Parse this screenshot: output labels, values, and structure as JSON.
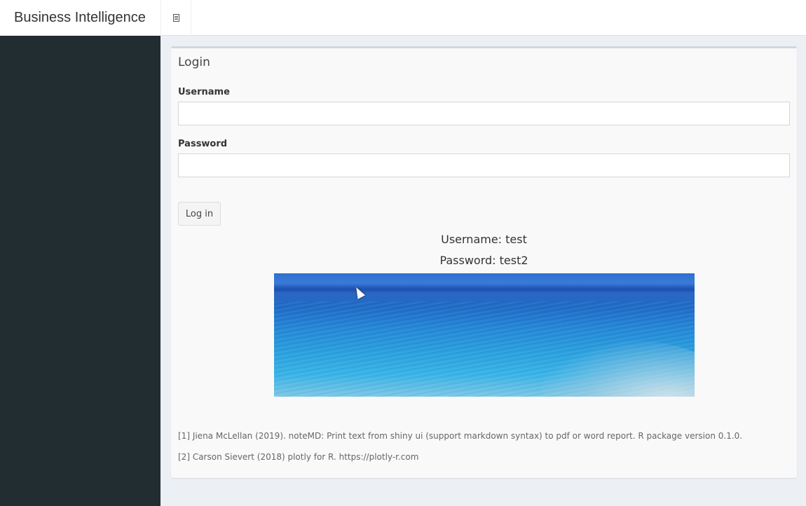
{
  "header": {
    "app_title": "Business Intelligence",
    "toggle_icon": "sidebar-toggle-icon"
  },
  "login": {
    "title": "Login",
    "username_label": "Username",
    "username_value": "",
    "password_label": "Password",
    "password_value": "",
    "login_button": "Log in"
  },
  "credentials": {
    "username_line": "Username: test",
    "password_line": "Password: test2"
  },
  "references": [
    "[1] Jiena McLellan (2019). noteMD: Print text from shiny ui (support markdown syntax) to pdf or word report. R package version 0.1.0.",
    "[2] Carson Sievert (2018) plotly for R. https://plotly-r.com"
  ],
  "colors": {
    "sidebar": "#222d32",
    "content_bg": "#ecf0f5",
    "box_bg": "#f9f9f9"
  }
}
